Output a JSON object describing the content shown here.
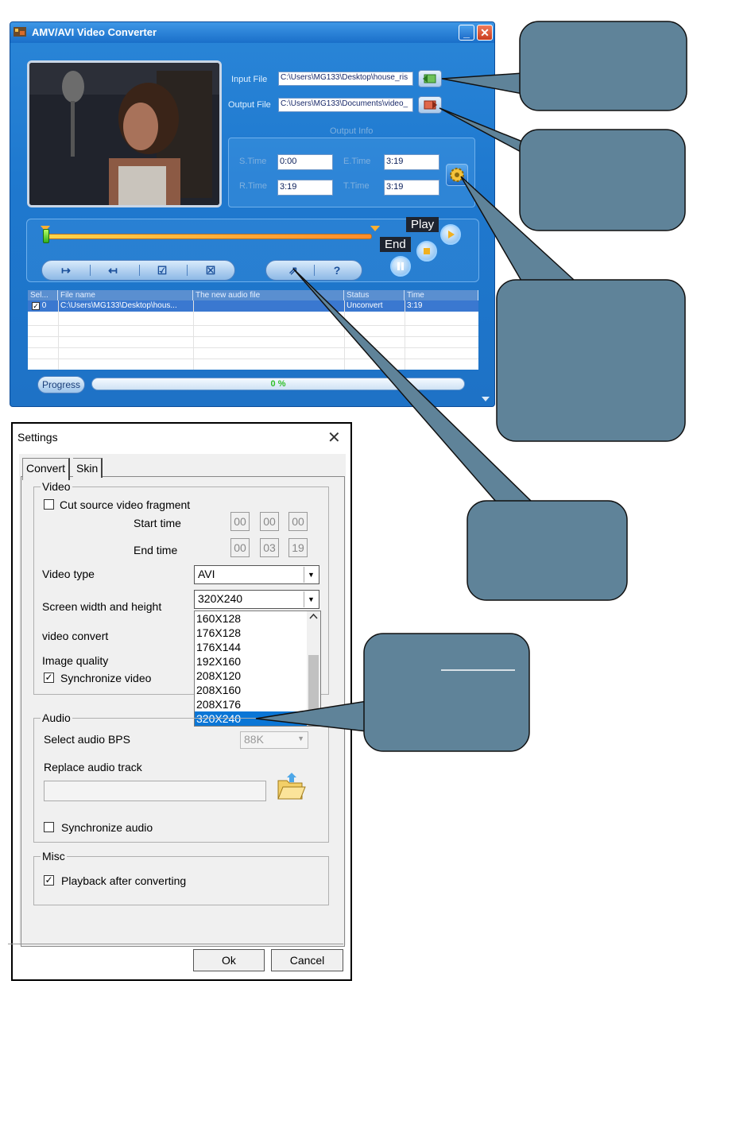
{
  "converter": {
    "title": "AMV/AVI Video Converter",
    "minimize": "_",
    "close": "✕",
    "input_label": "Input File",
    "input_path": "C:\\Users\\MG133\\Desktop\\house_ris",
    "output_label": "Output File",
    "output_path": "C:\\Users\\MG133\\Documents\\video_",
    "output_info_label": "Output Info",
    "s_time_label": "S.Time",
    "s_time": "0:00",
    "e_time_label": "E.Time",
    "e_time": "3:19",
    "r_time_label": "R.Time",
    "r_time": "3:19",
    "t_time_label": "T.Time",
    "t_time": "3:19",
    "tip_play": "Play",
    "tip_end": "End",
    "btn_set_start": "↦",
    "btn_set_end": "↤",
    "btn_check": "☑",
    "btn_uncheck": "☒",
    "btn_convert": "⇗",
    "btn_help": "?",
    "table": {
      "headers": [
        "Sel...",
        "File name",
        "The new audio file",
        "Status",
        "Time"
      ],
      "row": {
        "index": "0",
        "file": "C:\\Users\\MG133\\Desktop\\hous...",
        "new_file": "",
        "status": "Unconvert",
        "time": "3:19"
      }
    },
    "progress_label": "Progress",
    "progress_value": "0 %"
  },
  "settings": {
    "title": "Settings",
    "close": "✕",
    "tabs": [
      "Convert",
      "Skin"
    ],
    "video_group": "Video",
    "cut_fragment": "Cut source video fragment",
    "start_time_label": "Start time",
    "start_time": [
      "00",
      "00",
      "00"
    ],
    "end_time_label": "End time",
    "end_time": [
      "00",
      "03",
      "19"
    ],
    "video_type_label": "Video type",
    "video_type": "AVI",
    "screen_size_label": "Screen width and height",
    "screen_size": "320X240",
    "screen_options": [
      "160X128",
      "176X128",
      "176X144",
      "192X160",
      "208X120",
      "208X160",
      "208X176",
      "320X240"
    ],
    "video_convert_label": "video convert",
    "image_quality_label": "Image quality",
    "sync_video": "Synchronize video",
    "audio_group": "Audio",
    "audio_bps_label": "Select audio BPS",
    "audio_bps": "88K",
    "replace_audio_label": "Replace audio track",
    "sync_audio": "Synchronize audio",
    "misc_group": "Misc",
    "playback_after": "Playback after converting",
    "ok": "Ok",
    "cancel": "Cancel",
    "checked_mark": "✓"
  }
}
